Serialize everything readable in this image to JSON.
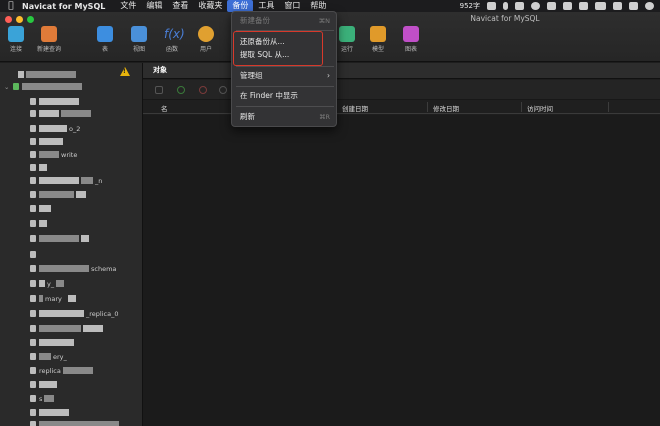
{
  "menubar": {
    "app_name": "Navicat for MySQL",
    "items": [
      "文件",
      "编辑",
      "查看",
      "收藏夹",
      "备份",
      "工具",
      "窗口",
      "帮助"
    ],
    "active_item": "备份",
    "status_text": "952字"
  },
  "window": {
    "title": "Navicat for MySQL"
  },
  "toolbar": {
    "items": [
      {
        "label": "连接",
        "icon": "connect-icon",
        "color": "#3aa3d8"
      },
      {
        "label": "新建查询",
        "icon": "new-query-icon",
        "color": "#e07b39"
      },
      {
        "label": "表",
        "icon": "table-icon",
        "color": "#3d8ee0"
      },
      {
        "label": "视图",
        "icon": "view-icon",
        "color": "#4a90d9"
      },
      {
        "label": "函数",
        "icon": "function-icon",
        "color": "#4a7fd8"
      },
      {
        "label": "用户",
        "icon": "user-icon",
        "color": "#e0a030"
      },
      {
        "label": "自动运行",
        "icon": "automation-icon",
        "color": "#3bb07a"
      },
      {
        "label": "模型",
        "icon": "model-icon",
        "color": "#e09a2a"
      },
      {
        "label": "图表",
        "icon": "chart-icon",
        "color": "#c04fc8"
      }
    ]
  },
  "backup_menu": {
    "new_backup": "新建备份",
    "new_backup_shortcut": "⌘N",
    "restore_from": "还原备份从...",
    "extract_sql": "提取 SQL 从...",
    "manage_group": "管理组",
    "show_in_finder": "在 Finder 中显示",
    "refresh": "刷新",
    "refresh_shortcut": "⌘R"
  },
  "main": {
    "tab_label": "对象",
    "columns": [
      "名",
      "创建日期",
      "修改日期",
      "访问时间"
    ]
  },
  "sidebar": {
    "fragments": [
      "_2",
      "o_2",
      "write",
      "_n",
      "schema",
      "y_",
      "mary",
      "_replica_0",
      "ery_",
      "replica",
      "s"
    ]
  },
  "colors": {
    "accent": "#3d6fd6",
    "highlight_box": "#d8392b",
    "warning": "#e6b30c"
  }
}
